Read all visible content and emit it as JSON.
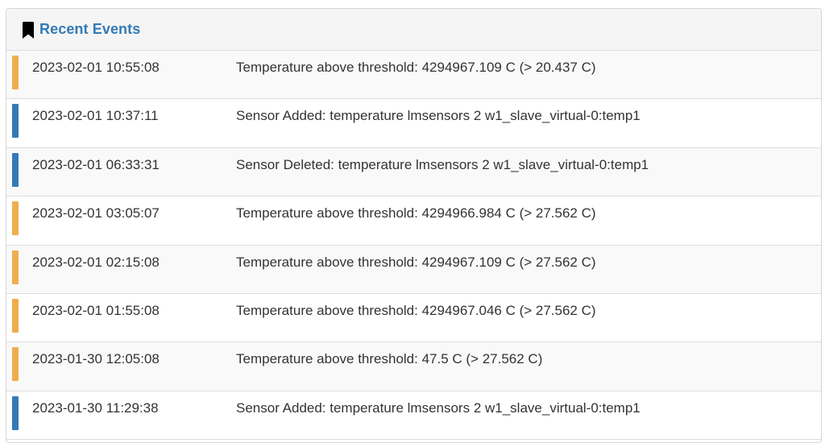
{
  "panel": {
    "title": "Recent Events",
    "icon": "bookmark-icon"
  },
  "colors": {
    "warning": "#f0ad4e",
    "info": "#337ab7"
  },
  "events": [
    {
      "time": "2023-02-01 10:55:08",
      "message": "Temperature above threshold: 4294967.109 C (> 20.437 C)",
      "level": "warning"
    },
    {
      "time": "2023-02-01 10:37:11",
      "message": "Sensor Added: temperature lmsensors 2 w1_slave_virtual-0:temp1",
      "level": "info"
    },
    {
      "time": "2023-02-01 06:33:31",
      "message": "Sensor Deleted: temperature lmsensors 2 w1_slave_virtual-0:temp1",
      "level": "info"
    },
    {
      "time": "2023-02-01 03:05:07",
      "message": "Temperature above threshold: 4294966.984 C (> 27.562 C)",
      "level": "warning"
    },
    {
      "time": "2023-02-01 02:15:08",
      "message": "Temperature above threshold: 4294967.109 C (> 27.562 C)",
      "level": "warning"
    },
    {
      "time": "2023-02-01 01:55:08",
      "message": "Temperature above threshold: 4294967.046 C (> 27.562 C)",
      "level": "warning"
    },
    {
      "time": "2023-01-30 12:05:08",
      "message": "Temperature above threshold: 47.5 C (> 27.562 C)",
      "level": "warning"
    },
    {
      "time": "2023-01-30 11:29:38",
      "message": "Sensor Added: temperature lmsensors 2 w1_slave_virtual-0:temp1",
      "level": "info"
    }
  ]
}
